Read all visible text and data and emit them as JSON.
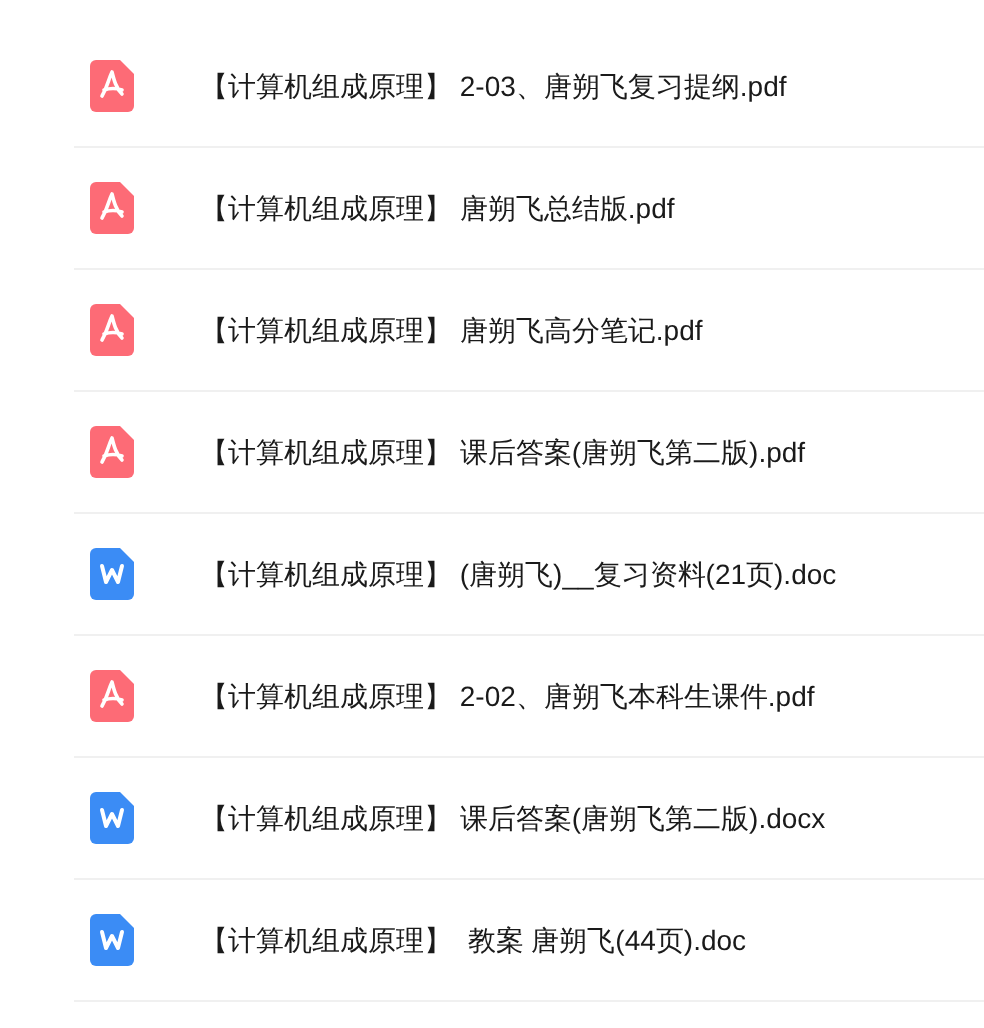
{
  "files": [
    {
      "kind": "pdf",
      "name": "【计算机组成原理】 2-03、唐朔飞复习提纲.pdf"
    },
    {
      "kind": "pdf",
      "name": "【计算机组成原理】 唐朔飞总结版.pdf"
    },
    {
      "kind": "pdf",
      "name": "【计算机组成原理】 唐朔飞高分笔记.pdf"
    },
    {
      "kind": "pdf",
      "name": "【计算机组成原理】 课后答案(唐朔飞第二版).pdf"
    },
    {
      "kind": "word",
      "name": "【计算机组成原理】 (唐朔飞)__复习资料(21页).doc"
    },
    {
      "kind": "pdf",
      "name": "【计算机组成原理】 2-02、唐朔飞本科生课件.pdf"
    },
    {
      "kind": "word",
      "name": "【计算机组成原理】 课后答案(唐朔飞第二版).docx"
    },
    {
      "kind": "word",
      "name": "【计算机组成原理】  教案 唐朔飞(44页).doc"
    }
  ]
}
